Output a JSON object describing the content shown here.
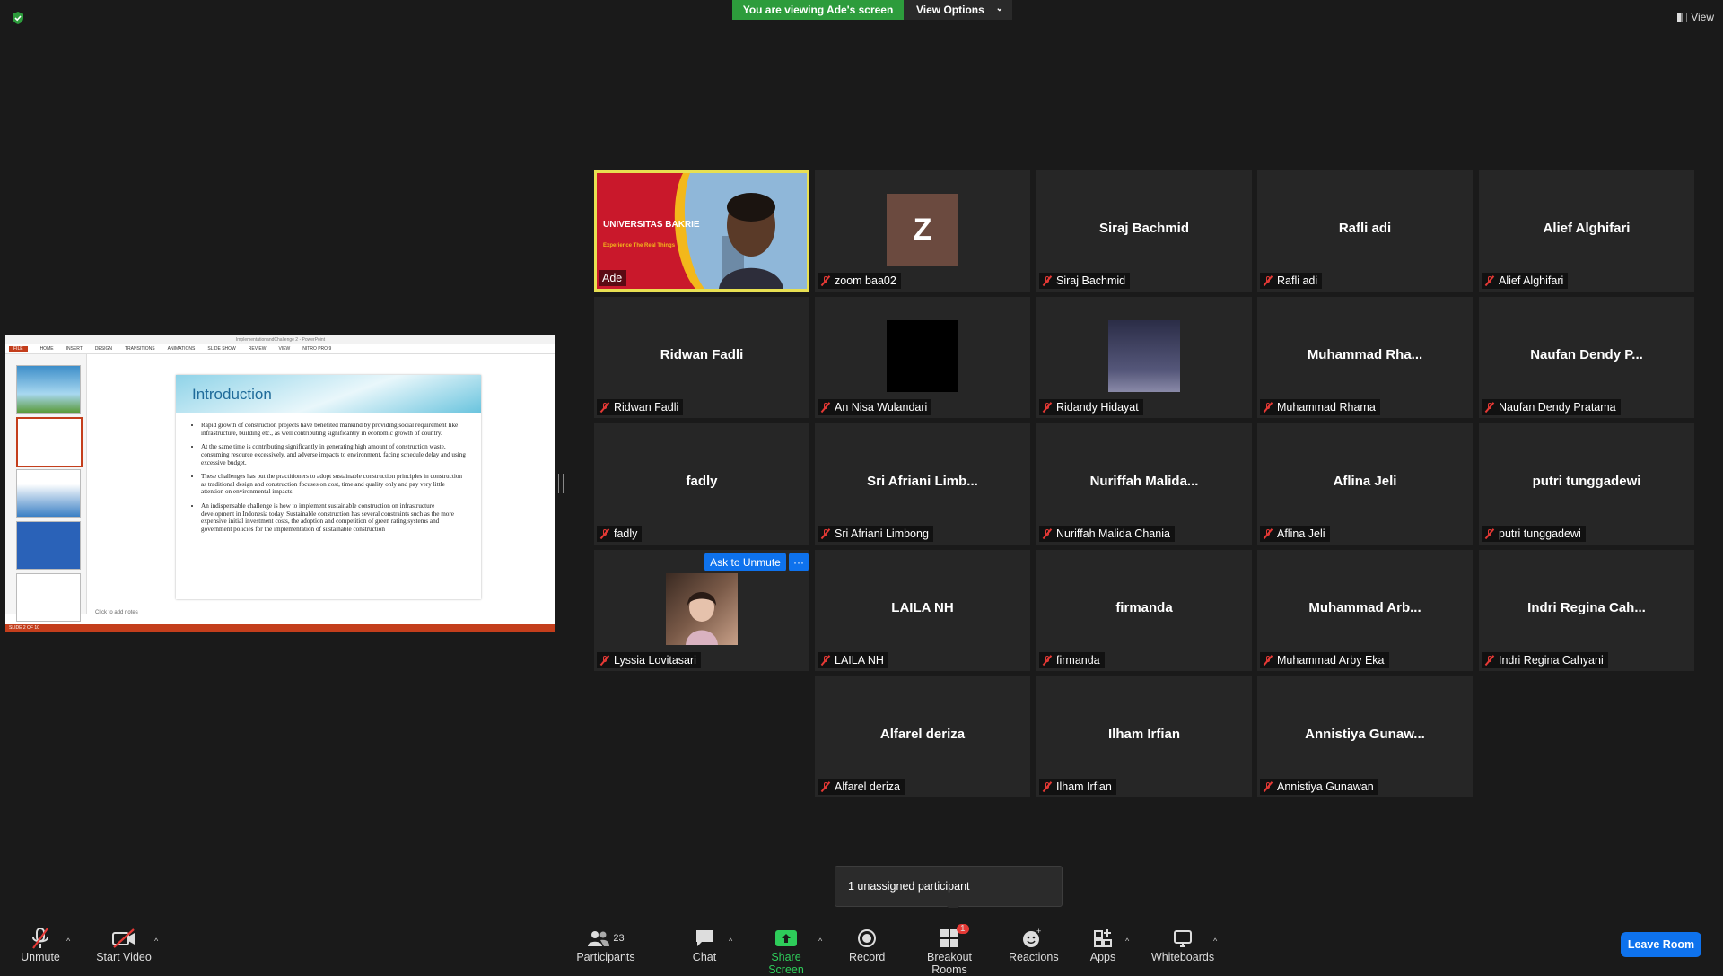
{
  "banner": {
    "viewing": "You are viewing Ade's screen",
    "view_options": "View Options",
    "view": "View"
  },
  "share": {
    "window_title": "ImplementationandChallenge 2 - PowerPoint",
    "ribbon_tabs": [
      "FILE",
      "HOME",
      "INSERT",
      "DESIGN",
      "TRANSITIONS",
      "ANIMATIONS",
      "SLIDE SHOW",
      "REVIEW",
      "VIEW",
      "NITRO PRO 9"
    ],
    "slide_title": "Introduction",
    "bullets": [
      "Rapid growth of construction projects have benefited mankind by providing social requirement like infrastructure, building etc., as well contributing significantly in economic growth of country.",
      "At the same time is contributing significantly in generating high amount of construction waste, consuming resource excessively, and adverse impacts to environment, facing schedule delay and using excessive budget.",
      "These challenges has put the practitioners to adopt sustainable construction principles in construction as traditional design and construction focuses on cost, time and quality only and pay very little attention on environmental impacts.",
      "An indispensable challenge is how to implement sustainable construction on infrastructure development in Indonesia today. Sustainable construction has several constraints such as the more expensive initial investment costs, the adoption and competition of green rating systems and government policies for the implementation of sustainable construction"
    ],
    "notes": "Click to add notes",
    "status": "SLIDE 2 OF 10"
  },
  "tiles": [
    {
      "name": "",
      "label": "Ade",
      "kind": "video",
      "muted": false
    },
    {
      "name": "",
      "label": "zoom baa02",
      "kind": "z",
      "letter": "Z",
      "muted": true
    },
    {
      "name": "Siraj Bachmid",
      "label": "Siraj Bachmid",
      "muted": true
    },
    {
      "name": "Rafli adi",
      "label": "Rafli adi",
      "muted": true
    },
    {
      "name": "Alief Alghifari",
      "label": "Alief Alghifari",
      "muted": true
    },
    {
      "name": "Ridwan Fadli",
      "label": "Ridwan Fadli",
      "muted": true
    },
    {
      "name": "",
      "label": "An Nisa Wulandari",
      "kind": "black",
      "muted": true
    },
    {
      "name": "",
      "label": "Ridandy Hidayat",
      "kind": "purple",
      "muted": true
    },
    {
      "name": "Muhammad Rha...",
      "label": "Muhammad Rhama",
      "muted": true
    },
    {
      "name": "Naufan Dendy P...",
      "label": "Naufan Dendy Pratama",
      "muted": true
    },
    {
      "name": "fadly",
      "label": "fadly",
      "muted": true
    },
    {
      "name": "Sri Afriani Limb...",
      "label": "Sri Afriani Limbong",
      "muted": true
    },
    {
      "name": "Nuriffah Malida...",
      "label": "Nuriffah Malida Chania",
      "muted": true
    },
    {
      "name": "Aflina Jeli",
      "label": "Aflina Jeli",
      "muted": true
    },
    {
      "name": "putri tunggadewi",
      "label": "putri tunggadewi",
      "muted": true
    },
    {
      "name": "",
      "label": "Lyssia Lovitasari",
      "kind": "photo",
      "muted": true
    },
    {
      "name": "LAILA NH",
      "label": "LAILA NH",
      "muted": true
    },
    {
      "name": "firmanda",
      "label": "firmanda",
      "muted": true
    },
    {
      "name": "Muhammad Arb...",
      "label": "Muhammad Arby Eka",
      "muted": true
    },
    {
      "name": "Indri Regina Cah...",
      "label": "Indri Regina Cahyani",
      "muted": true
    },
    {
      "name": "Alfarel deriza",
      "label": "Alfarel deriza",
      "muted": true
    },
    {
      "name": "Ilham Irfian",
      "label": "Ilham Irfian",
      "muted": true
    },
    {
      "name": "Annistiya Gunaw...",
      "label": "Annistiya Gunawan",
      "muted": true
    }
  ],
  "ade_video": {
    "university": "UNIVERSITAS BAKRIE",
    "tagline": "Experience The Real Things"
  },
  "ask_unmute": "Ask to Unmute",
  "more": "···",
  "tooltip": "1 unassigned participant",
  "toolbar": {
    "unmute": "Unmute",
    "start_video": "Start Video",
    "participants": "Participants",
    "participants_count": "23",
    "chat": "Chat",
    "share_screen": "Share Screen",
    "record": "Record",
    "breakout_rooms": "Breakout Rooms",
    "breakout_badge": "1",
    "reactions": "Reactions",
    "apps": "Apps",
    "whiteboards": "Whiteboards",
    "leave_room": "Leave Room"
  },
  "colors": {
    "green": "#2d9c3c",
    "blue": "#0e72ed",
    "active_border": "#e8e052",
    "mute_red": "#e53935"
  }
}
